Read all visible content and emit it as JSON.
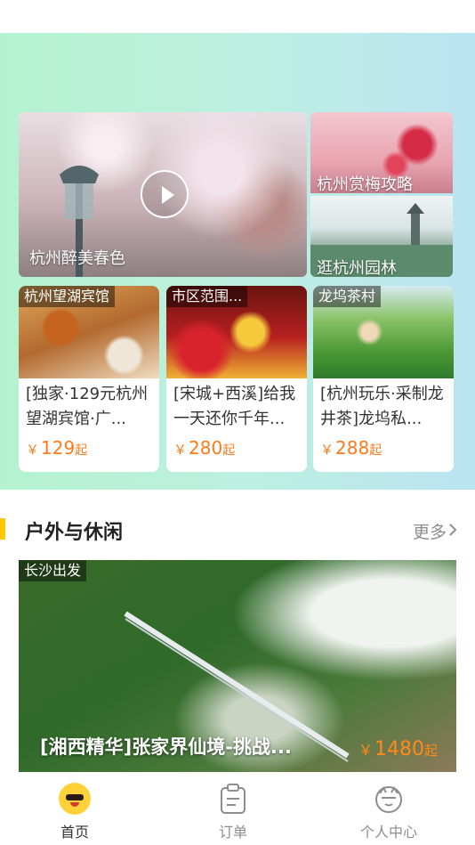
{
  "hero": {
    "main_card": {
      "caption": "杭州醉美春色"
    },
    "side_cards": [
      {
        "caption": "杭州赏梅攻略"
      },
      {
        "caption": "逛杭州园林"
      }
    ]
  },
  "products": [
    {
      "tag": "杭州望湖宾馆",
      "title": "[独家·129元杭州望湖宾馆·广...",
      "price": "129",
      "yen": "￥",
      "suffix": "起"
    },
    {
      "tag": "市区范围...",
      "title": "[宋城+西溪]给我一天还你千年...",
      "price": "280",
      "yen": "￥",
      "suffix": "起"
    },
    {
      "tag": "龙坞茶村",
      "title": "[杭州玩乐·采制龙井茶]龙坞私...",
      "price": "288",
      "yen": "￥",
      "suffix": "起"
    }
  ],
  "section": {
    "title": "户外与休闲",
    "more_label": "更多",
    "more_icon": "chevron-right-icon"
  },
  "featured": {
    "tag": "长沙出发",
    "title": "[湘西精华]张家界仙境-挑战...",
    "yen": "￥",
    "price": "1480",
    "suffix": "起"
  },
  "tabbar": {
    "active_color": "#333333",
    "inactive_color": "#8d8d8d",
    "tabs": [
      {
        "label": "首页",
        "icon": "home-mascot-icon",
        "active": true
      },
      {
        "label": "订单",
        "icon": "orders-icon",
        "active": false
      },
      {
        "label": "个人中心",
        "icon": "profile-icon",
        "active": false
      }
    ]
  },
  "colors": {
    "accent": "#ff7a1a",
    "section_bar": "#ffc800",
    "hero_gradient_start": "#b4f2cf",
    "hero_gradient_end": "#b9e4f2"
  }
}
